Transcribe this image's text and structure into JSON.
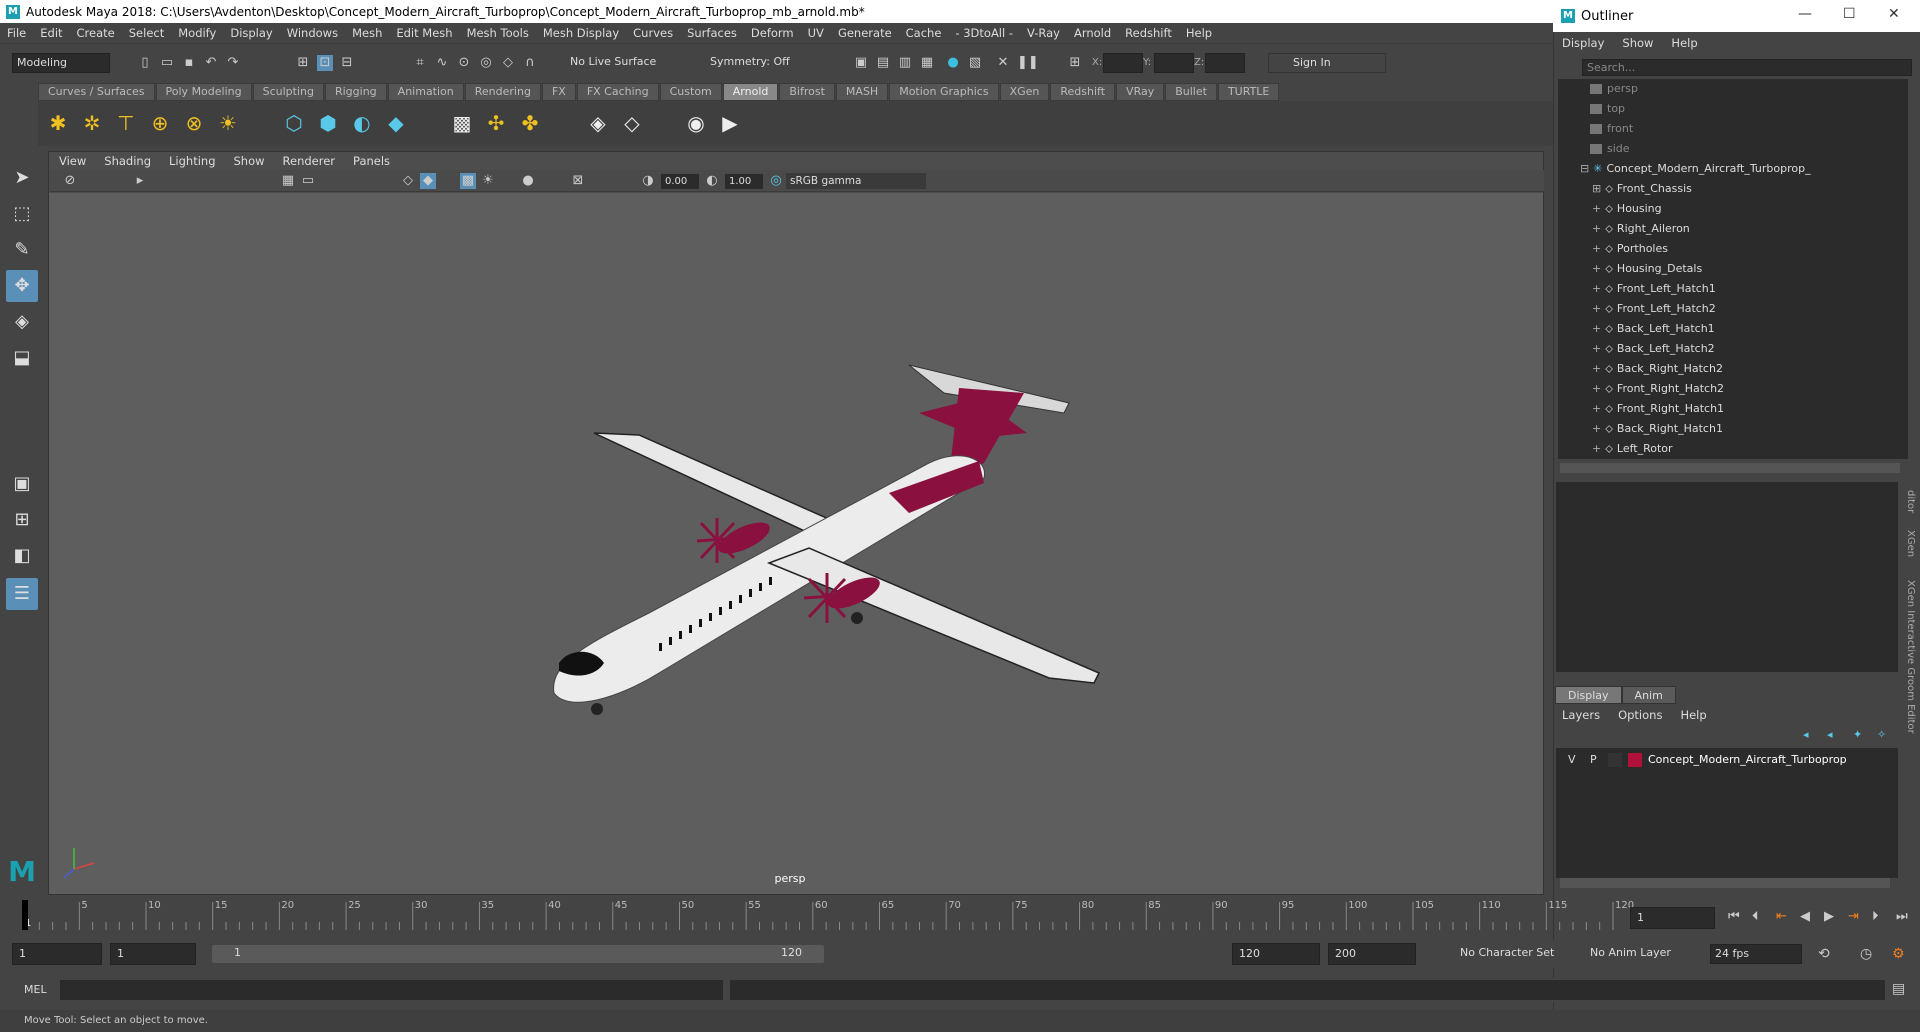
{
  "window": {
    "title": "Autodesk Maya 2018: C:\\Users\\Avdenton\\Desktop\\Concept_Modern_Aircraft_Turboprop\\Concept_Modern_Aircraft_Turboprop_mb_arnold.mb*"
  },
  "menubar": [
    "File",
    "Edit",
    "Create",
    "Select",
    "Modify",
    "Display",
    "Windows",
    "Mesh",
    "Edit Mesh",
    "Mesh Tools",
    "Mesh Display",
    "Curves",
    "Surfaces",
    "Deform",
    "UV",
    "Generate",
    "Cache",
    "- 3DtoAll -",
    "V-Ray",
    "Arnold",
    "Redshift",
    "Help"
  ],
  "statusline": {
    "mode": "Modeling",
    "live_surface": "No Live Surface",
    "symmetry": "Symmetry: Off",
    "x_label": "X:",
    "y_label": "Y:",
    "z_label": "Z:",
    "sign_in": "Sign In"
  },
  "shelf_tabs": [
    "Curves / Surfaces",
    "Poly Modeling",
    "Sculpting",
    "Rigging",
    "Animation",
    "Rendering",
    "FX",
    "FX Caching",
    "Custom",
    "Arnold",
    "Bifrost",
    "MASH",
    "Motion Graphics",
    "XGen",
    "Redshift",
    "VRay",
    "Bullet",
    "TURTLE"
  ],
  "shelf_active": "Arnold",
  "viewport": {
    "menu": [
      "View",
      "Shading",
      "Lighting",
      "Show",
      "Renderer",
      "Panels"
    ],
    "exposure": "0.00",
    "gamma": "1.00",
    "colorspace": "sRGB gamma",
    "camera_label": "persp"
  },
  "outliner": {
    "title": "Outliner",
    "menu": [
      "Display",
      "Show",
      "Help"
    ],
    "search_placeholder": "Search...",
    "cameras": [
      "persp",
      "top",
      "front",
      "side"
    ],
    "root": "Concept_Modern_Aircraft_Turboprop_",
    "children": [
      "Front_Chassis",
      "Housing",
      "Right_Aileron",
      "Portholes",
      "Housing_Detals",
      "Front_Left_Hatch1",
      "Front_Left_Hatch2",
      "Back_Left_Hatch1",
      "Back_Left_Hatch2",
      "Back_Right_Hatch2",
      "Front_Right_Hatch2",
      "Front_Right_Hatch1",
      "Back_Right_Hatch1",
      "Left_Rotor"
    ]
  },
  "side_tabs": [
    "ditor",
    "XGen",
    "XGen Interactive Groom Editor"
  ],
  "layer_editor": {
    "tabs": [
      "Display",
      "Anim"
    ],
    "active_tab": "Display",
    "menu": [
      "Layers",
      "Options",
      "Help"
    ],
    "layer": {
      "v": "V",
      "p": "P",
      "name": "Concept_Modern_Aircraft_Turboprop",
      "color": "#b0103a"
    }
  },
  "timeline": {
    "ticks": [
      "5",
      "10",
      "15",
      "20",
      "25",
      "30",
      "35",
      "40",
      "45",
      "50",
      "55",
      "60",
      "65",
      "70",
      "75",
      "80",
      "85",
      "90",
      "95",
      "100",
      "105",
      "110",
      "115",
      "120"
    ],
    "first_tick": "1",
    "current_frame": "1"
  },
  "range": {
    "start": "1",
    "playback_start": "1",
    "slider_start": "1",
    "slider_end": "120",
    "playback_end": "120",
    "end": "200",
    "character_set": "No Character Set",
    "anim_layer": "No Anim Layer",
    "fps": "24 fps"
  },
  "cmdline": {
    "label": "MEL"
  },
  "helpline": {
    "text": "Move Tool: Select an object to move."
  },
  "colors": {
    "accent": "#5a8fb8",
    "aircraft_livery": "#8a1040",
    "maya_teal": "#1aa0b0"
  }
}
